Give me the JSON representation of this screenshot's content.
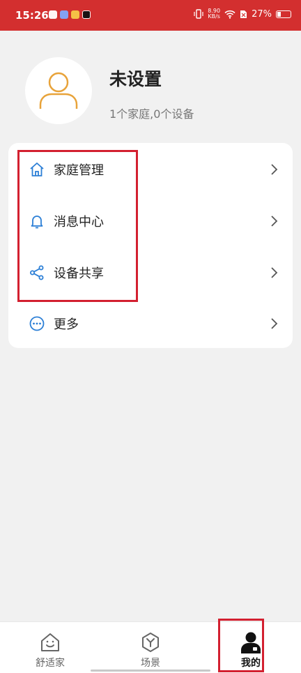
{
  "status_bar": {
    "time": "15:26",
    "net_speed_value": "8.90",
    "net_speed_unit": "KB/s",
    "battery": "27%"
  },
  "profile": {
    "name": "未设置",
    "summary": "1个家庭,0个设备"
  },
  "menu": {
    "items": [
      {
        "label": "家庭管理",
        "icon": "home-icon"
      },
      {
        "label": "消息中心",
        "icon": "bell-icon"
      },
      {
        "label": "设备共享",
        "icon": "share-icon"
      },
      {
        "label": "更多",
        "icon": "more-icon"
      }
    ]
  },
  "bottom_nav": {
    "tabs": [
      {
        "label": "舒适家",
        "icon": "house-smile-icon"
      },
      {
        "label": "场景",
        "icon": "scene-icon"
      },
      {
        "label": "我的",
        "icon": "user-icon",
        "active": true
      }
    ]
  },
  "colors": {
    "status_bar": "#d32f2f",
    "accent_blue": "#2c7fd6",
    "highlight": "#d32030",
    "avatar_outline": "#e8a33a"
  }
}
